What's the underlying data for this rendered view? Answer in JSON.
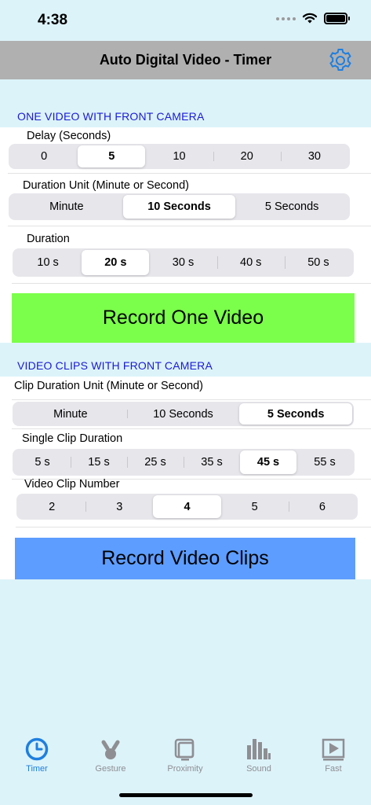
{
  "status": {
    "time": "4:38"
  },
  "nav": {
    "title": "Auto Digital Video - Timer"
  },
  "section1": {
    "header": "ONE VIDEO WITH FRONT CAMERA",
    "delay": {
      "label": "Delay (Seconds)",
      "options": [
        "0",
        "5",
        "10",
        "20",
        "30"
      ],
      "selected": "5"
    },
    "duration_unit": {
      "label": "Duration Unit (Minute or Second)",
      "options": [
        "Minute",
        "10 Seconds",
        "5 Seconds"
      ],
      "selected": "10 Seconds"
    },
    "duration": {
      "label": "Duration",
      "options": [
        "10 s",
        "20 s",
        "30 s",
        "40 s",
        "50 s"
      ],
      "selected": "20 s"
    },
    "record_button": "Record One Video",
    "record_color": "#7bff4a"
  },
  "section2": {
    "header": "VIDEO CLIPS WITH FRONT CAMERA",
    "clip_unit": {
      "label": "Clip Duration Unit (Minute or Second)",
      "options": [
        "Minute",
        "10 Seconds",
        "5 Seconds"
      ],
      "selected": "5 Seconds"
    },
    "single_clip": {
      "label": "Single Clip Duration",
      "options": [
        "5 s",
        "15 s",
        "25 s",
        "35 s",
        "45 s",
        "55 s"
      ],
      "selected": "45 s"
    },
    "clip_number": {
      "label": "Video Clip Number",
      "options": [
        "2",
        "3",
        "4",
        "5",
        "6"
      ],
      "selected": "4"
    },
    "record_button": "Record Video Clips",
    "record_color": "#5d9dff"
  },
  "tabs": [
    {
      "label": "Timer",
      "icon": "clock-icon",
      "active": true
    },
    {
      "label": "Gesture",
      "icon": "hand-icon",
      "active": false
    },
    {
      "label": "Proximity",
      "icon": "proximity-icon",
      "active": false
    },
    {
      "label": "Sound",
      "icon": "sound-bars-icon",
      "active": false
    },
    {
      "label": "Fast",
      "icon": "play-icon",
      "active": false
    }
  ],
  "colors": {
    "accent": "#1e7fe0",
    "section_header": "#1a1ad6",
    "background": "#dcf3f9"
  }
}
